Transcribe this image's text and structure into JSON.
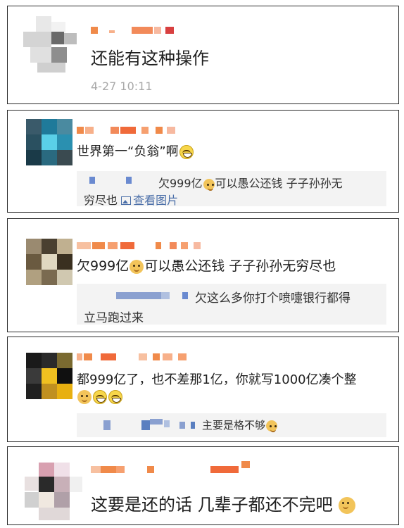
{
  "comments": [
    {
      "text": "还能有这种操作",
      "timestamp": "4-27 10:11"
    },
    {
      "text_before": "世界第一“负翁”啊",
      "emoji_after": "laugh",
      "reply": {
        "text_a": "欠999亿",
        "text_b": "可以愚公还钱 子子孙孙无",
        "text_c": "穷尽也",
        "view_image": "查看图片"
      }
    },
    {
      "text_a": "欠999亿",
      "text_b": "可以愚公还钱 子子孙孙无穷尽也",
      "reply": {
        "line1": "欠这么多你打个喷嚏银行都得",
        "line2": "立马跑过来"
      }
    },
    {
      "text": "都999亿了，也不差那1亿，你就写1000亿凑个整",
      "emojis": [
        "doge",
        "laugh",
        "laugh"
      ],
      "reply": {
        "text": "主要是格不够"
      }
    },
    {
      "text": "这要是还的话 几辈子都还不完吧"
    }
  ],
  "colors": {
    "blur_orange": "#f08a4a",
    "blur_blue": "#5a7fc0",
    "border": "#2b2b2b",
    "reply_bg": "#f3f3f3",
    "link": "#4a6ea8"
  }
}
